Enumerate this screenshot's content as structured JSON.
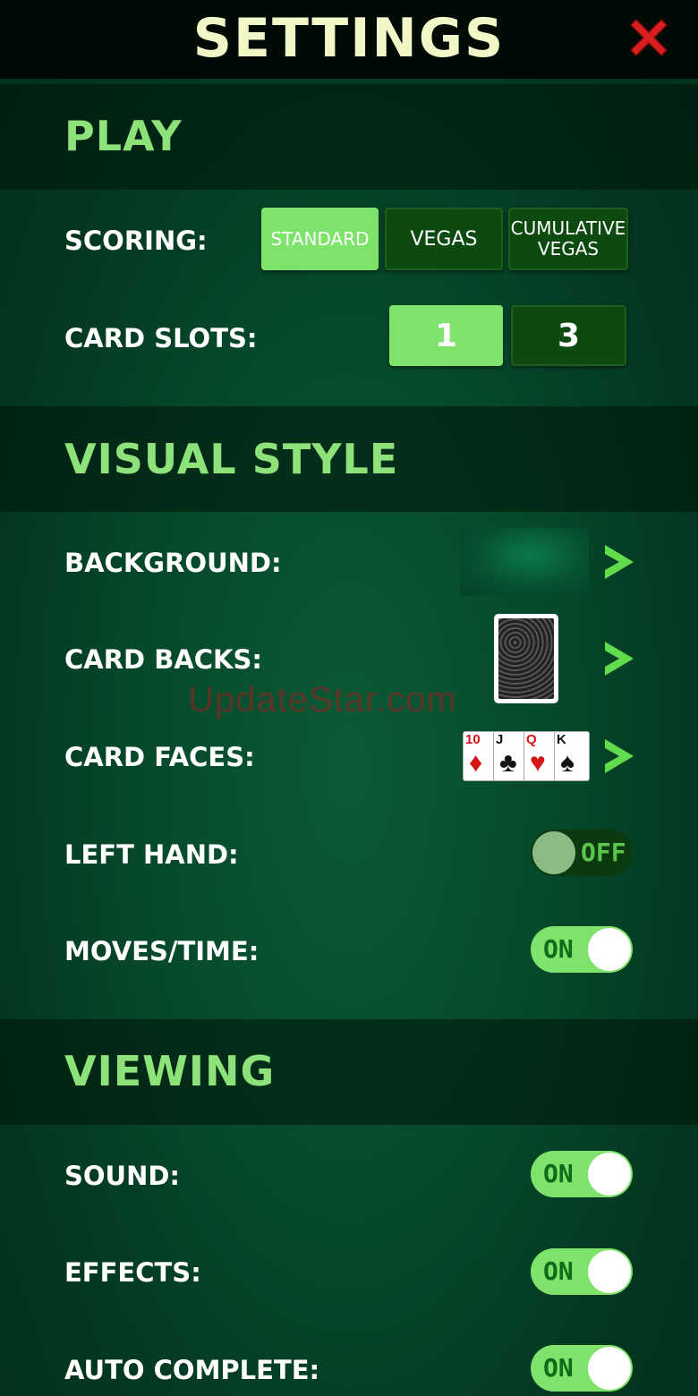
{
  "header": {
    "title": "SETTINGS",
    "close_icon": "close-x-icon",
    "close_color": "#d81e1e"
  },
  "sections": {
    "play": {
      "title": "PLAY",
      "scoring": {
        "label": "SCORING:",
        "options": [
          "STANDARD",
          "VEGAS",
          "CUMULATIVE",
          "VEGAS"
        ],
        "selected": "STANDARD"
      },
      "card_slots": {
        "label": "CARD SLOTS:",
        "options": [
          "1",
          "3"
        ],
        "selected": "1"
      }
    },
    "visual_style": {
      "title": "VISUAL STYLE",
      "background": {
        "label": "BACKGROUND:"
      },
      "card_backs": {
        "label": "CARD BACKS:"
      },
      "card_faces": {
        "label": "CARD FACES:",
        "cards": [
          "10",
          "J",
          "Q",
          "K"
        ]
      },
      "left_hand": {
        "label": "LEFT HAND:",
        "state": "OFF"
      },
      "moves_time": {
        "label": "MOVES/TIME:",
        "state": "ON"
      }
    },
    "viewing": {
      "title": "VIEWING",
      "sound": {
        "label": "SOUND:",
        "state": "ON"
      },
      "effects": {
        "label": "EFFECTS:",
        "state": "ON"
      },
      "auto_complete": {
        "label": "AUTO COMPLETE:",
        "state": "ON"
      }
    }
  },
  "watermark": "UpdateStar.com",
  "colors": {
    "accent": "#7ee36b",
    "section_title": "#8ee27a",
    "title": "#f2f7c8"
  }
}
